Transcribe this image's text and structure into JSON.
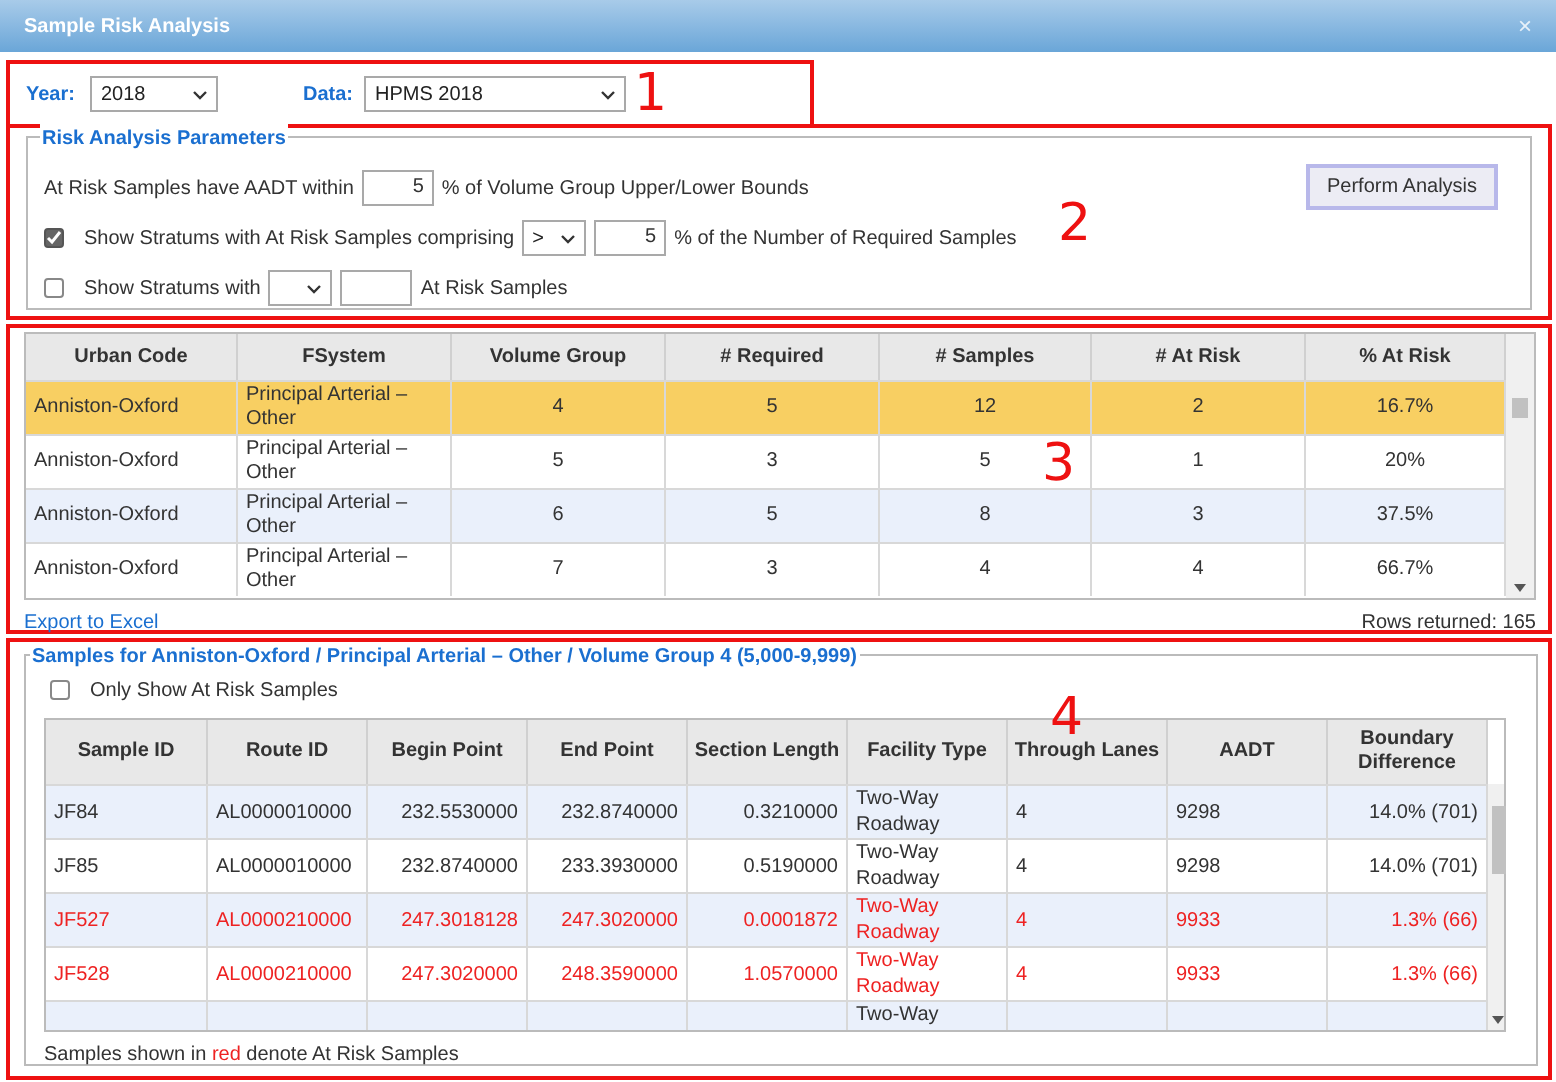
{
  "window": {
    "title": "Sample Risk Analysis",
    "close": "×"
  },
  "filters": {
    "year_label": "Year:",
    "year": "2018",
    "data_label": "Data:",
    "data": "HPMS 2018"
  },
  "parameters": {
    "legend": "Risk Analysis Parameters",
    "row1": {
      "before": "At Risk Samples have AADT within",
      "value": "5",
      "after": "% of Volume Group Upper/Lower Bounds"
    },
    "row2": {
      "checked": true,
      "before": "Show Stratums with At Risk Samples comprising",
      "operator": ">",
      "value": "5",
      "after": "% of the Number of Required Samples"
    },
    "row3": {
      "checked": false,
      "before": "Show Stratums with",
      "after": "At Risk Samples"
    },
    "button": "Perform Analysis"
  },
  "strata": {
    "columns": [
      "Urban Code",
      "FSystem",
      "Volume Group",
      "# Required",
      "# Samples",
      "# At Risk",
      "% At Risk"
    ],
    "rows": [
      {
        "selected": true,
        "cells": [
          "Anniston-Oxford",
          "Principal Arterial – Other",
          "4",
          "5",
          "12",
          "2",
          "16.7%"
        ]
      },
      {
        "selected": false,
        "cells": [
          "Anniston-Oxford",
          "Principal Arterial – Other",
          "5",
          "3",
          "5",
          "1",
          "20%"
        ]
      },
      {
        "selected": false,
        "cells": [
          "Anniston-Oxford",
          "Principal Arterial – Other",
          "6",
          "5",
          "8",
          "3",
          "37.5%"
        ]
      },
      {
        "selected": false,
        "cells": [
          "Anniston-Oxford",
          "Principal Arterial – Other",
          "7",
          "3",
          "4",
          "4",
          "66.7%"
        ]
      }
    ],
    "export_link": "Export to Excel",
    "rows_returned": "Rows returned: 165"
  },
  "samples": {
    "legend": "Samples for Anniston-Oxford / Principal Arterial – Other / Volume Group 4 (5,000-9,999)",
    "only_at_risk": {
      "label": "Only Show At Risk Samples",
      "checked": false
    },
    "columns": [
      "Sample ID",
      "Route ID",
      "Begin Point",
      "End Point",
      "Section Length",
      "Facility Type",
      "Through Lanes",
      "AADT",
      "Boundary Difference"
    ],
    "rows": [
      {
        "at_risk": false,
        "cells": [
          "JF84",
          "AL0000010000",
          "232.5530000",
          "232.8740000",
          "0.3210000",
          "Two-Way Roadway",
          "4",
          "9298",
          "14.0% (701)"
        ]
      },
      {
        "at_risk": false,
        "cells": [
          "JF85",
          "AL0000010000",
          "232.8740000",
          "233.3930000",
          "0.5190000",
          "Two-Way Roadway",
          "4",
          "9298",
          "14.0% (701)"
        ]
      },
      {
        "at_risk": true,
        "cells": [
          "JF527",
          "AL0000210000",
          "247.3018128",
          "247.3020000",
          "0.0001872",
          "Two-Way Roadway",
          "4",
          "9933",
          "1.3% (66)"
        ]
      },
      {
        "at_risk": true,
        "cells": [
          "JF528",
          "AL0000210000",
          "247.3020000",
          "248.3590000",
          "1.0570000",
          "Two-Way Roadway",
          "4",
          "9933",
          "1.3% (66)"
        ]
      },
      {
        "at_risk": false,
        "cells": [
          null,
          null,
          null,
          null,
          null,
          "Two-Way",
          null,
          null,
          null
        ]
      }
    ],
    "note": {
      "before": "Samples shown in ",
      "highlight": "red",
      "after": " denote At Risk Samples"
    }
  },
  "annotations": [
    "1",
    "2",
    "3",
    "4"
  ]
}
